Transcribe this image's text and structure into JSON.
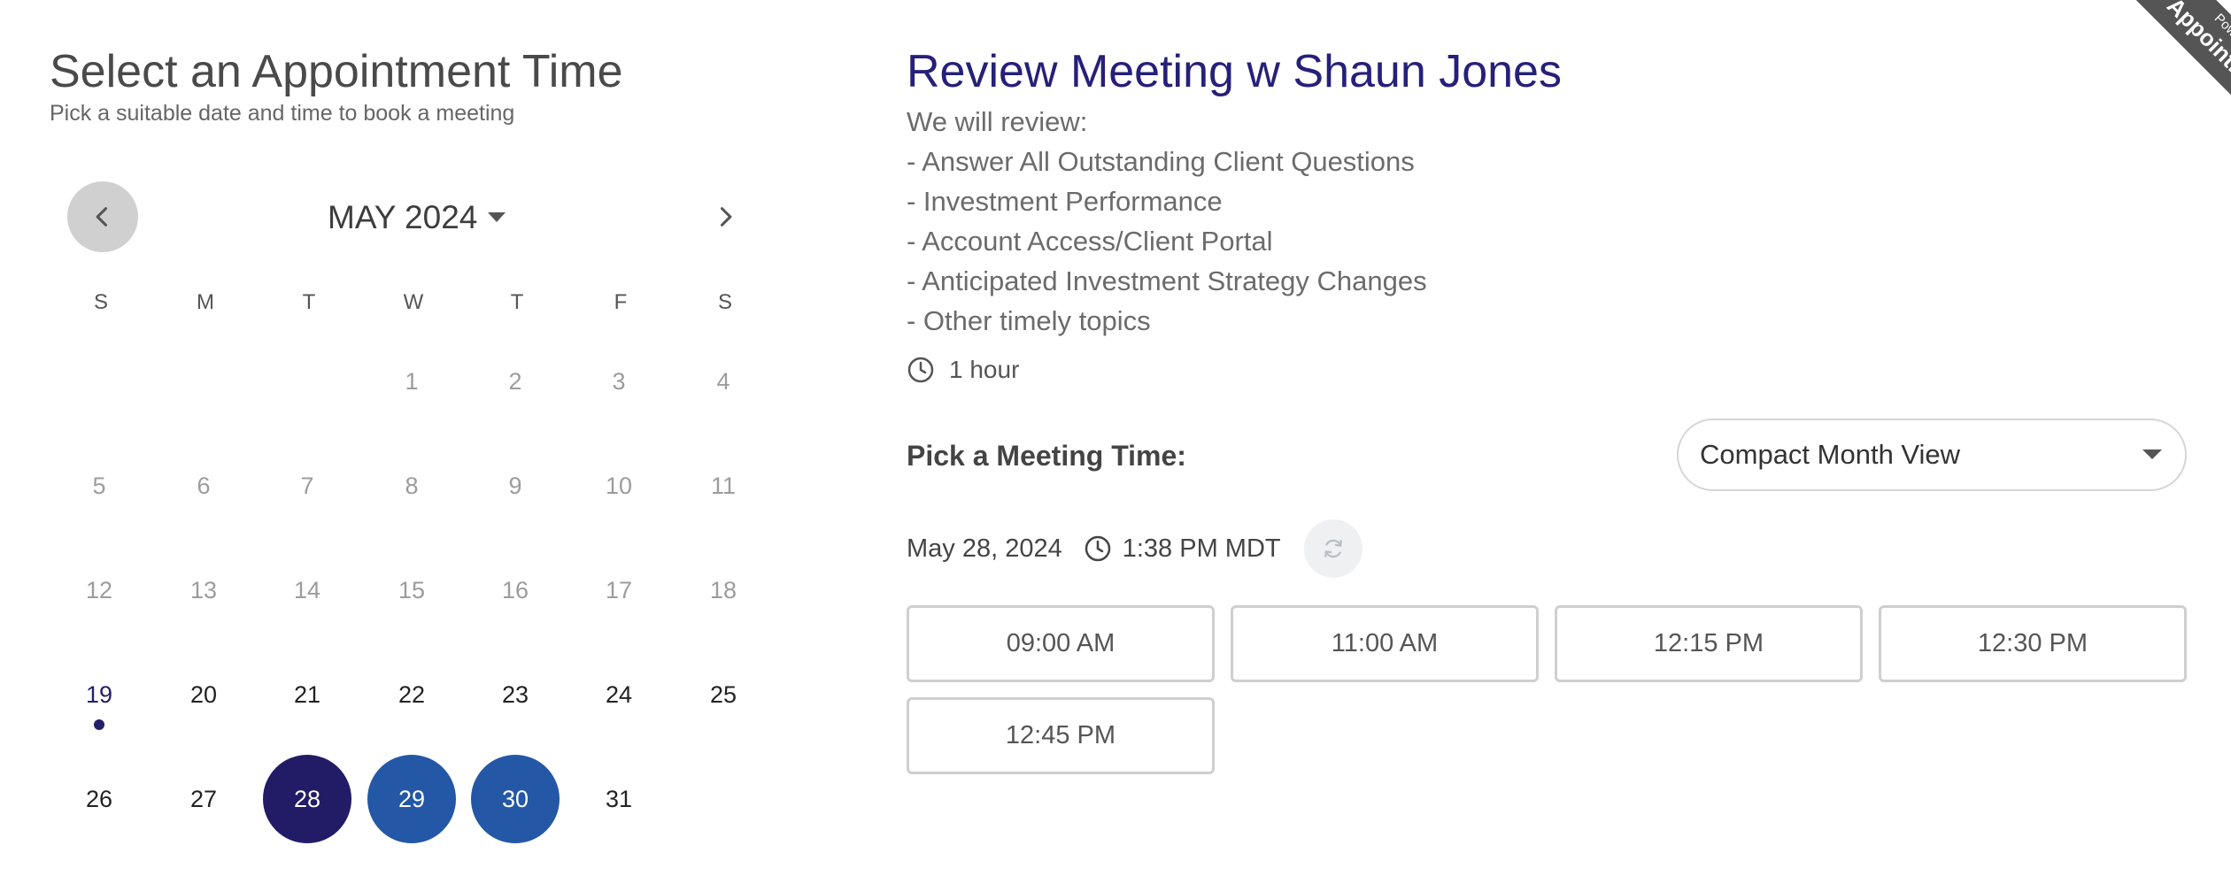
{
  "header": {
    "title": "Select an Appointment Time",
    "subtitle": "Pick a suitable date and time to book a meeting"
  },
  "calendar": {
    "month_label": "MAY 2024",
    "weekdays": [
      "S",
      "M",
      "T",
      "W",
      "T",
      "F",
      "S"
    ],
    "weeks": [
      [
        null,
        null,
        null,
        "1",
        "2",
        "3",
        "4"
      ],
      [
        "5",
        "6",
        "7",
        "8",
        "9",
        "10",
        "11"
      ],
      [
        "12",
        "13",
        "14",
        "15",
        "16",
        "17",
        "18"
      ],
      [
        "19",
        "20",
        "21",
        "22",
        "23",
        "24",
        "25"
      ],
      [
        "26",
        "27",
        "28",
        "29",
        "30",
        "31",
        null
      ]
    ],
    "today": "19",
    "selected": "28",
    "available_highlighted": [
      "29",
      "30"
    ],
    "colors": {
      "selected": "#221b66",
      "available": "#2457a6",
      "today": "#23206b",
      "prev_button": "#d0d0d0"
    }
  },
  "meeting": {
    "title": "Review Meeting w Shaun Jones",
    "description": [
      " We will review:",
      "- Answer All Outstanding Client Questions",
      "- Investment Performance",
      "- Account Access/Client Portal",
      "- Anticipated Investment Strategy Changes",
      "- Other timely topics"
    ],
    "duration": "1 hour",
    "duration_icon": "clock-icon"
  },
  "picker": {
    "label": "Pick a Meeting Time:",
    "view_select": {
      "value": "Compact Month View"
    },
    "selected_date": "May 28, 2024",
    "current_time": "1:38 PM MDT",
    "slots": [
      "09:00 AM",
      "11:00 AM",
      "12:15 PM",
      "12:30 PM",
      "12:45 PM"
    ]
  },
  "ribbon": {
    "small": "Powered by",
    "big": "Appointments"
  }
}
